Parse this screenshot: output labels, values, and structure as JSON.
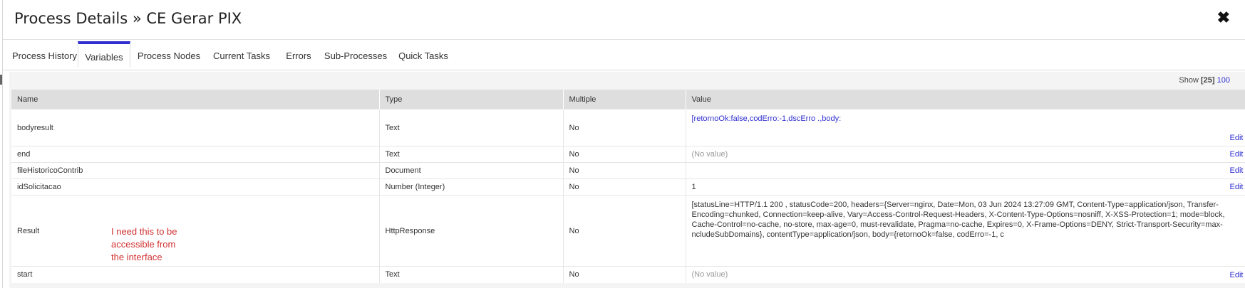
{
  "header": {
    "title": "Process Details » CE Gerar PIX",
    "close_label": "✖"
  },
  "tabs": [
    {
      "label": "Process History"
    },
    {
      "label": "Variables"
    },
    {
      "label": "Process Nodes"
    },
    {
      "label": "Current Tasks"
    },
    {
      "label": "Errors"
    },
    {
      "label": "Sub-Processes"
    },
    {
      "label": "Quick Tasks"
    }
  ],
  "active_tab": "Variables",
  "pager": {
    "show_label": "Show",
    "current": "[25]",
    "other": "100"
  },
  "table": {
    "columns": [
      "Name",
      "Type",
      "Multiple",
      "Value"
    ],
    "rows": [
      {
        "name": "bodyresult",
        "type": "Text",
        "multiple": "No",
        "value": "[retornoOk:false,codErro:-1,dscErro                                                        .,body:",
        "edit": "Edit"
      },
      {
        "name": "end",
        "type": "Text",
        "multiple": "No",
        "value": "(No value)",
        "edit": "Edit"
      },
      {
        "name": "fileHistoricoContrib",
        "type": "Document",
        "multiple": "No",
        "value": "",
        "edit": "Edit"
      },
      {
        "name": "idSolicitacao",
        "type": "Number (Integer)",
        "multiple": "No",
        "value": "1",
        "edit": "Edit"
      },
      {
        "name": "Result",
        "type": "HttpResponse",
        "multiple": "No",
        "value": "[statusLine=HTTP/1.1 200 , statusCode=200, headers={Server=nginx, Date=Mon, 03 Jun 2024 13:27:09 GMT, Content-Type=application/json, Transfer-Encoding=chunked, Connection=keep-alive, Vary=Access-Control-Request-Headers, X-Content-Type-Options=nosniff, X-XSS-Protection=1; mode=block, Cache-Control=no-cache, no-store, max-age=0, must-revalidate, Pragma=no-cache, Expires=0, X-Frame-Options=DENY, Strict-Transport-Security=max-                    ncludeSubDomains}, contentType=application/json, body={retornoOk=false, codErro=-1, c",
        "edit": ""
      },
      {
        "name": "start",
        "type": "Text",
        "multiple": "No",
        "value": "(No value)",
        "edit": "Edit"
      }
    ]
  },
  "annotation": "I need this to be accessible from the interface"
}
